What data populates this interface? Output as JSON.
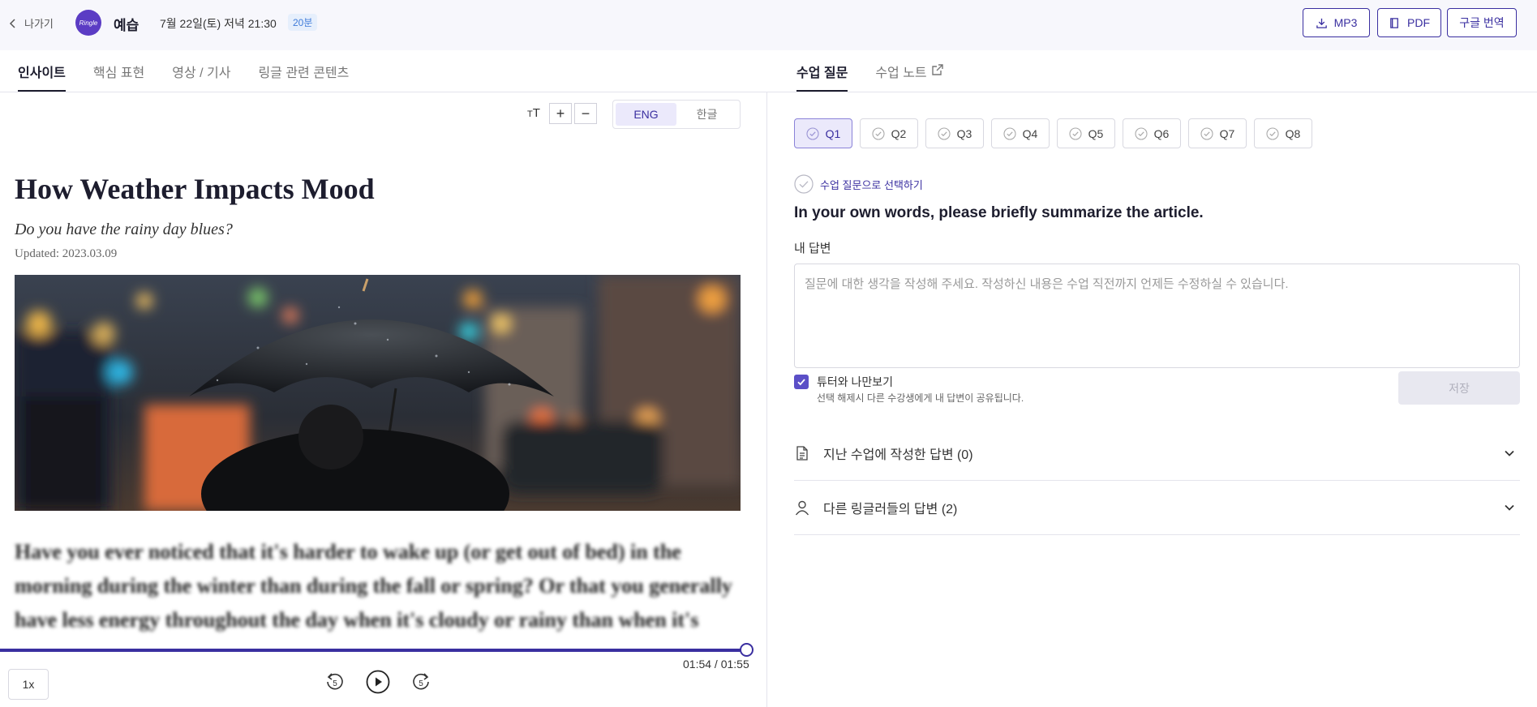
{
  "header": {
    "back_label": "나가기",
    "logo_text": "Ringle",
    "mode": "예습",
    "datetime": "7월 22일(토) 저녁 21:30",
    "duration": "20분",
    "buttons": {
      "mp3": "MP3",
      "pdf": "PDF",
      "translate": "구글 번역"
    }
  },
  "left_tabs": [
    "인사이트",
    "핵심 표현",
    "영상 / 기사",
    "링글 관련 콘텐츠"
  ],
  "right_tabs": [
    "수업 질문",
    "수업 노트"
  ],
  "reader": {
    "text_size_icon": "text-size-icon",
    "plus": "+",
    "minus": "−",
    "lang_eng": "ENG",
    "lang_kor": "한글"
  },
  "article": {
    "title": "How Weather Impacts Mood",
    "subtitle": "Do you have the rainy day blues?",
    "updated": "Updated: 2023.03.09",
    "body": "Have you ever noticed that it's harder to wake up (or get out of bed) in the morning during the winter than during the fall or spring? Or that you generally have less energy throughout the day when it's cloudy or rainy than when it's"
  },
  "player": {
    "progress": 0.991,
    "time": "01:54 / 01:55",
    "speed": "1x",
    "rewind_seconds": "5",
    "forward_seconds": "5"
  },
  "questions": {
    "tabs": [
      "Q1",
      "Q2",
      "Q3",
      "Q4",
      "Q5",
      "Q6",
      "Q7",
      "Q8"
    ],
    "active_tab": "Q1",
    "select_label": "수업 질문으로 선택하기",
    "question_text": "In your own words, please briefly summarize the article.",
    "answer_label": "내 답변",
    "answer_placeholder": "질문에 대한 생각을 작성해 주세요. 작성하신 내용은 수업 직전까지 언제든 수정하실 수 있습니다.",
    "answer_value": "",
    "share_label": "튜터와 나만보기",
    "share_hint": "선택 해제시 다른 수강생에게 내 답변이 공유됩니다.",
    "save_label": "저장",
    "past_answers": "지난 수업에 작성한 답변 (0)",
    "others_answers": "다른 링글러들의 답변 (2)"
  },
  "colors": {
    "accent": "#3a2fa0",
    "accent_light": "#ebe9fb",
    "badge_blue": "#3f7bd9"
  }
}
